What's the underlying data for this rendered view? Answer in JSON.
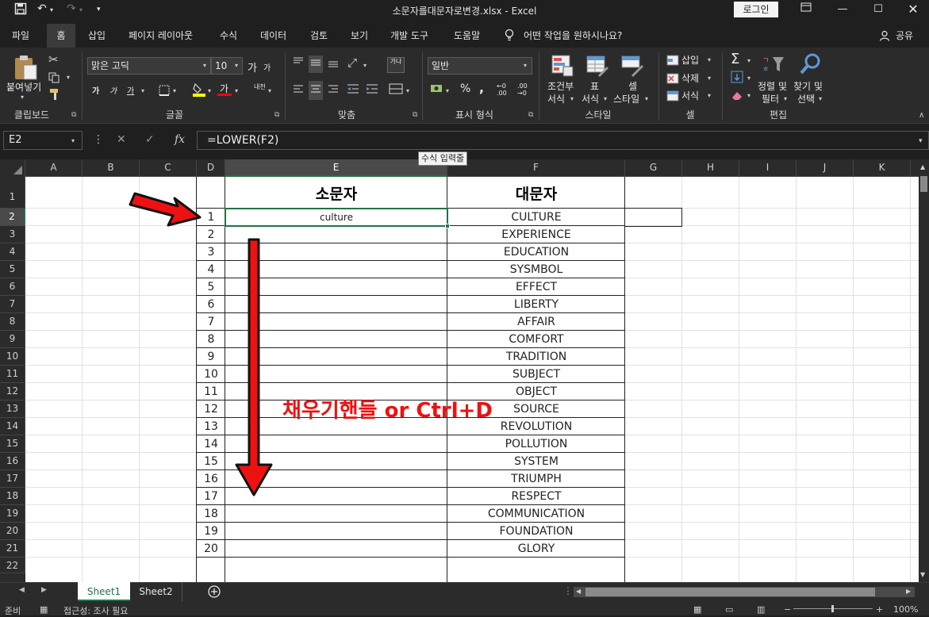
{
  "window": {
    "title": "소문자를대문자로변경.xlsx  -  Excel",
    "login": "로그인"
  },
  "tabs": [
    "파일",
    "홈",
    "삽입",
    "페이지 레이아웃",
    "수식",
    "데이터",
    "검토",
    "보기",
    "개발 도구",
    "도움말"
  ],
  "tell_me": "어떤 작업을 원하시나요?",
  "share": "공유",
  "ribbon": {
    "clipboard": {
      "paste": "붙여넣기",
      "label": "클립보드"
    },
    "font": {
      "name": "맑은 고딕",
      "size": "10",
      "label": "글꼴",
      "grow": "가",
      "shrink": "가",
      "bold": "가",
      "italic": "가",
      "underline": "가",
      "color_a": "가",
      "phonetic": "내천"
    },
    "alignment": {
      "label": "맞춤",
      "wrap": "가나"
    },
    "number": {
      "format": "일반",
      "label": "표시 형식",
      "percent": "%",
      "comma": ","
    },
    "styles": {
      "label": "스타일",
      "cond1": "조건부",
      "cond2": "서식",
      "table1": "표",
      "table2": "서식",
      "cell1": "셀",
      "cell2": "스타일"
    },
    "cells": {
      "label": "셀",
      "insert": "삽입",
      "delete": "삭제",
      "format": "서식"
    },
    "editing": {
      "label": "편집",
      "sort1": "정렬 및",
      "sort2": "필터",
      "find1": "찾기 및",
      "find2": "선택"
    }
  },
  "formula_bar": {
    "name_box": "E2",
    "formula": "=LOWER(F2)",
    "tooltip": "수식 입력줄"
  },
  "columns": [
    "A",
    "B",
    "C",
    "D",
    "E",
    "F",
    "G",
    "H",
    "I",
    "J",
    "K"
  ],
  "row_numbers": [
    "1",
    "2",
    "3",
    "4",
    "5",
    "6",
    "7",
    "8",
    "9",
    "10",
    "11",
    "12",
    "13",
    "14",
    "15",
    "16",
    "17",
    "18",
    "19",
    "20",
    "21",
    "22"
  ],
  "table": {
    "header_e": "소문자",
    "header_f": "대문자",
    "rows": [
      {
        "n": "1",
        "lower": "culture",
        "upper": "CULTURE"
      },
      {
        "n": "2",
        "lower": "",
        "upper": "EXPERIENCE"
      },
      {
        "n": "3",
        "lower": "",
        "upper": "EDUCATION"
      },
      {
        "n": "4",
        "lower": "",
        "upper": "SYSMBOL"
      },
      {
        "n": "5",
        "lower": "",
        "upper": "EFFECT"
      },
      {
        "n": "6",
        "lower": "",
        "upper": "LIBERTY"
      },
      {
        "n": "7",
        "lower": "",
        "upper": "AFFAIR"
      },
      {
        "n": "8",
        "lower": "",
        "upper": "COMFORT"
      },
      {
        "n": "9",
        "lower": "",
        "upper": "TRADITION"
      },
      {
        "n": "10",
        "lower": "",
        "upper": "SUBJECT"
      },
      {
        "n": "11",
        "lower": "",
        "upper": "OBJECT"
      },
      {
        "n": "12",
        "lower": "",
        "upper": "SOURCE"
      },
      {
        "n": "13",
        "lower": "",
        "upper": "REVOLUTION"
      },
      {
        "n": "14",
        "lower": "",
        "upper": "POLLUTION"
      },
      {
        "n": "15",
        "lower": "",
        "upper": "SYSTEM"
      },
      {
        "n": "16",
        "lower": "",
        "upper": "TRIUMPH"
      },
      {
        "n": "17",
        "lower": "",
        "upper": "RESPECT"
      },
      {
        "n": "18",
        "lower": "",
        "upper": "COMMUNICATION"
      },
      {
        "n": "19",
        "lower": "",
        "upper": "FOUNDATION"
      },
      {
        "n": "20",
        "lower": "",
        "upper": "GLORY"
      }
    ]
  },
  "annotation": "채우기핸들 or Ctrl+D",
  "sheets": [
    "Sheet1",
    "Sheet2"
  ],
  "status": {
    "ready": "준비",
    "accessibility": "접근성: 조사 필요",
    "zoom": "100%"
  },
  "colors": {
    "accent": "#217346",
    "annotation": "#ee1111"
  }
}
